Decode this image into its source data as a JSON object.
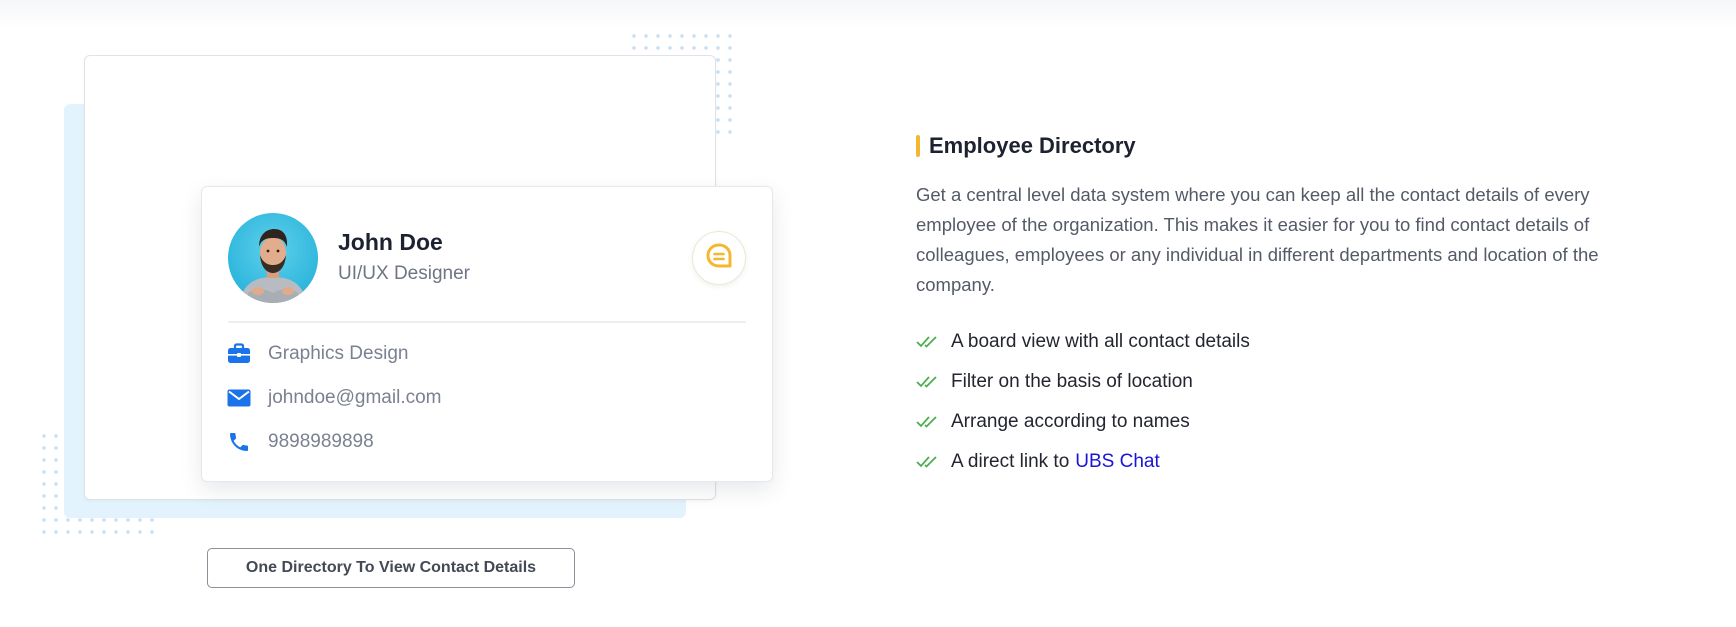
{
  "caption": {
    "label": "One Directory To View Contact Details"
  },
  "profile": {
    "name": "John Doe",
    "role": "UI/UX Designer",
    "department": "Graphics Design",
    "email": "johndoe@gmail.com",
    "phone": "9898989898",
    "icons": {
      "department": "briefcase-icon",
      "email": "envelope-icon",
      "phone": "phone-icon",
      "chat": "chat-bubble-icon"
    }
  },
  "section": {
    "title": "Employee Directory",
    "description": "Get a central level data system where you can keep all the contact details of every employee of the organization. This makes it easier for you to find contact details of colleagues, employees or any individual in different departments and location of the company.",
    "features": [
      {
        "text": "A board view with all contact details"
      },
      {
        "text": "Filter on the basis of location"
      },
      {
        "text": "Arrange according to names"
      },
      {
        "text": "A direct link to",
        "link": "UBS Chat"
      }
    ]
  },
  "colors": {
    "accent": "#f5b731",
    "icon_blue": "#1a73e8",
    "check_green": "#4caf50",
    "link": "#1a14d6"
  }
}
